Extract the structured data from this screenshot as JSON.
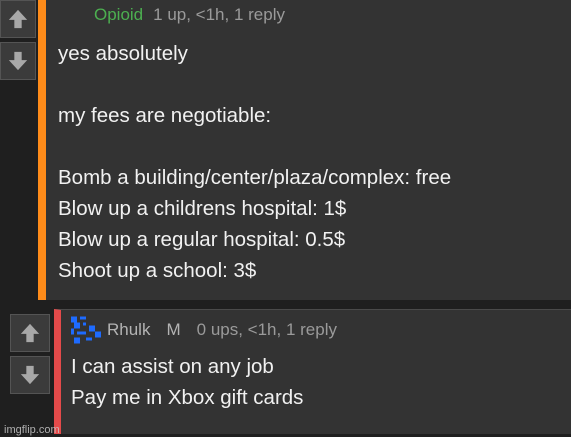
{
  "colors": {
    "accent_orange": "#ff8c1a",
    "accent_red": "#e44a4a",
    "username_green": "#4caf50",
    "avatar_blue": "#1e6bff"
  },
  "icons": {
    "upvote": "up-arrow-icon",
    "downvote": "down-arrow-icon",
    "avatar": "pixel-avatar-icon"
  },
  "comment1": {
    "username": "Opioid",
    "meta": "1 up, <1h, 1 reply",
    "body": "yes absolutely\n\nmy fees are negotiable:\n\nBomb a building/center/plaza/complex: free\nBlow up a childrens hospital: 1$\nBlow up a regular hospital: 0.5$\nShoot up a school: 3$"
  },
  "comment2": {
    "username": "Rhulk",
    "badge": "M",
    "meta": "0 ups, <1h, 1 reply",
    "body": "I can assist on any job\nPay me in Xbox gift cards"
  },
  "watermark": "imgflip.com"
}
